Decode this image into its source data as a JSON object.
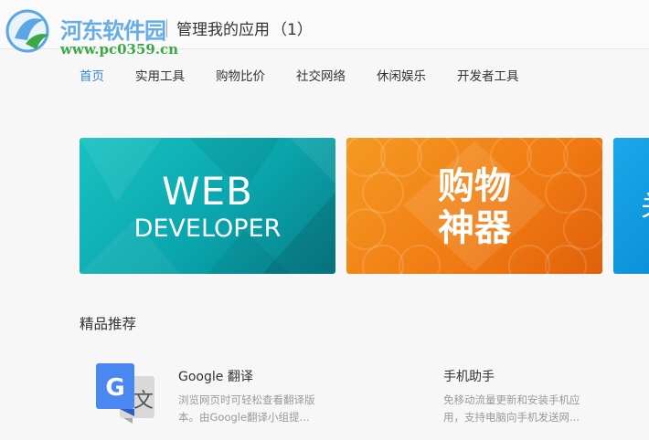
{
  "watermark": {
    "name": "河东软件园",
    "url": "www.pc0359.cn"
  },
  "breadcrumb": {
    "title": "管理我的应用",
    "count": "（1）"
  },
  "nav": {
    "items": [
      {
        "label": "首页",
        "active": true
      },
      {
        "label": "实用工具",
        "active": false
      },
      {
        "label": "购物比价",
        "active": false
      },
      {
        "label": "社交网络",
        "active": false
      },
      {
        "label": "休闲娱乐",
        "active": false
      },
      {
        "label": "开发者工具",
        "active": false
      }
    ]
  },
  "banners": {
    "web": {
      "line1": "WEB",
      "line2": "DEVELOPER",
      "color": "#0aa5ad"
    },
    "shop": {
      "line1": "购物",
      "line2": "神器",
      "color": "#f07a12"
    },
    "next": {
      "glyph": "关",
      "color": "#0b8fd8"
    }
  },
  "section": {
    "title": "精品推荐"
  },
  "apps": [
    {
      "name": "Google 翻译",
      "desc_line1": "浏览网页时可轻松查看翻译版",
      "desc_line2": "本。由Google翻译小组提...",
      "icon": "google-translate-icon"
    },
    {
      "name": "手机助手",
      "desc_line1": "免移动流量更新和安装手机应",
      "desc_line2": "用，支持电脑向手机发送网...",
      "icon": "phone-assistant-icon"
    }
  ],
  "colors": {
    "accent": "#2e86de",
    "watermark_blue": "#5aa6e6",
    "watermark_green": "#3aa847"
  }
}
